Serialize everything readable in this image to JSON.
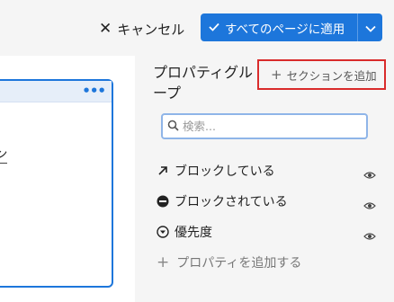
{
  "topbar": {
    "cancel_label": "キャンセル",
    "apply_label": "すべてのページに適用"
  },
  "preview": {
    "menu_glyph": "•••",
    "partial_text": "ーン"
  },
  "panel": {
    "title": "プロパティグループ",
    "add_section_label": "セクションを追加"
  },
  "search": {
    "placeholder": "検索..."
  },
  "properties": [
    {
      "label": "ブロックしている",
      "icon": "arrow-up-right-icon"
    },
    {
      "label": "ブロックされている",
      "icon": "blocked-circle-icon"
    },
    {
      "label": "優先度",
      "icon": "priority-circle-icon"
    }
  ],
  "add_property_label": "プロパティを追加する",
  "colors": {
    "accent": "#1d76db",
    "highlight": "#d92b2b"
  }
}
